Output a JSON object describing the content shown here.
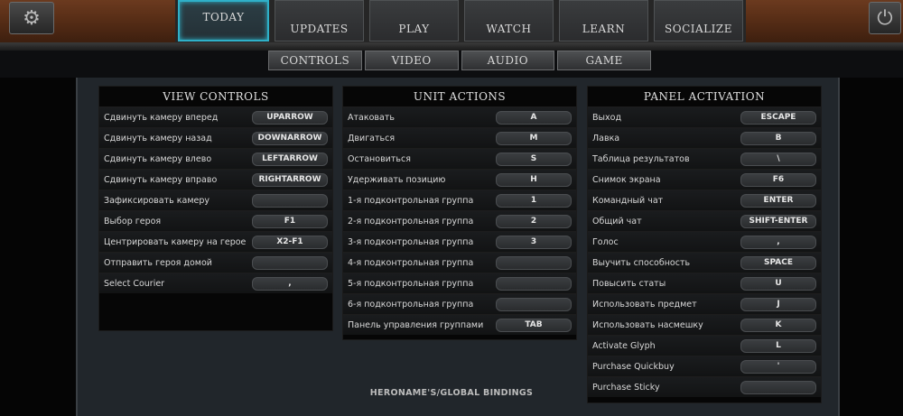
{
  "topbar": {
    "settings_icon": "gear-icon",
    "power_icon": "power-icon",
    "tabs": [
      "TODAY",
      "UPDATES",
      "PLAY",
      "WATCH",
      "LEARN",
      "SOCIALIZE"
    ],
    "active_tab": "TODAY"
  },
  "subtabs": [
    "CONTROLS",
    "VIDEO",
    "AUDIO",
    "GAME"
  ],
  "view_controls": {
    "title": "VIEW CONTROLS",
    "rows": [
      {
        "label": "Сдвинуть камеру вперед",
        "key": "UPARROW"
      },
      {
        "label": "Сдвинуть камеру назад",
        "key": "DOWNARROW"
      },
      {
        "label": "Сдвинуть камеру влево",
        "key": "LEFTARROW"
      },
      {
        "label": "Сдвинуть камеру вправо",
        "key": "RIGHTARROW"
      },
      {
        "label": "Зафиксировать камеру",
        "key": ""
      },
      {
        "label": "Выбор героя",
        "key": "F1"
      },
      {
        "label": "Центрировать камеру на герое",
        "key": "X2-F1"
      },
      {
        "label": "Отправить героя домой",
        "key": ""
      },
      {
        "label": "Select Courier",
        "key": ","
      }
    ]
  },
  "unit_actions": {
    "title": "UNIT ACTIONS",
    "rows": [
      {
        "label": "Атаковать",
        "key": "A"
      },
      {
        "label": "Двигаться",
        "key": "M"
      },
      {
        "label": "Остановиться",
        "key": "S"
      },
      {
        "label": "Удерживать позицию",
        "key": "H"
      },
      {
        "label": "1-я подконтрольная группа",
        "key": "1"
      },
      {
        "label": "2-я подконтрольная группа",
        "key": "2"
      },
      {
        "label": "3-я подконтрольная группа",
        "key": "3"
      },
      {
        "label": "4-я подконтрольная группа",
        "key": ""
      },
      {
        "label": "5-я подконтрольная группа",
        "key": ""
      },
      {
        "label": "6-я подконтрольная группа",
        "key": ""
      },
      {
        "label": "Панель управления группами",
        "key": "TAB"
      }
    ]
  },
  "panel_activation": {
    "title": "PANEL ACTIVATION",
    "rows": [
      {
        "label": "Выход",
        "key": "ESCAPE"
      },
      {
        "label": "Лавка",
        "key": "B"
      },
      {
        "label": "Таблица результатов",
        "key": "\\"
      },
      {
        "label": "Снимок экрана",
        "key": "F6"
      },
      {
        "label": "Командный чат",
        "key": "ENTER"
      },
      {
        "label": "Общий чат",
        "key": "SHIFT-ENTER"
      },
      {
        "label": "Голос",
        "key": ","
      },
      {
        "label": "Выучить способность",
        "key": "SPACE"
      },
      {
        "label": "Повысить статы",
        "key": "U"
      },
      {
        "label": "Использовать предмет",
        "key": "J"
      },
      {
        "label": "Использовать насмешку",
        "key": "K"
      },
      {
        "label": "Activate Glyph",
        "key": "L"
      },
      {
        "label": "Purchase Quickbuy",
        "key": "'"
      },
      {
        "label": "Purchase Sticky",
        "key": ""
      }
    ]
  },
  "footer": {
    "text": "HERONAME'S/GLOBAL BINDINGS"
  }
}
